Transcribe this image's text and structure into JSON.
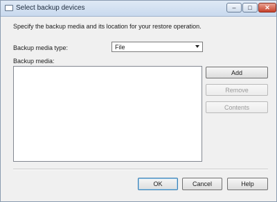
{
  "window": {
    "title": "Select backup devices",
    "controls": {
      "minimize": "–",
      "maximize": "□",
      "close": "✕"
    }
  },
  "description": "Specify the backup media and its location for your restore operation.",
  "media_type": {
    "label": "Backup media type:",
    "selected": "File"
  },
  "media_list": {
    "label": "Backup media:",
    "items": []
  },
  "side_buttons": {
    "add": "Add",
    "remove": "Remove",
    "contents": "Contents"
  },
  "footer_buttons": {
    "ok": "OK",
    "cancel": "Cancel",
    "help": "Help"
  }
}
